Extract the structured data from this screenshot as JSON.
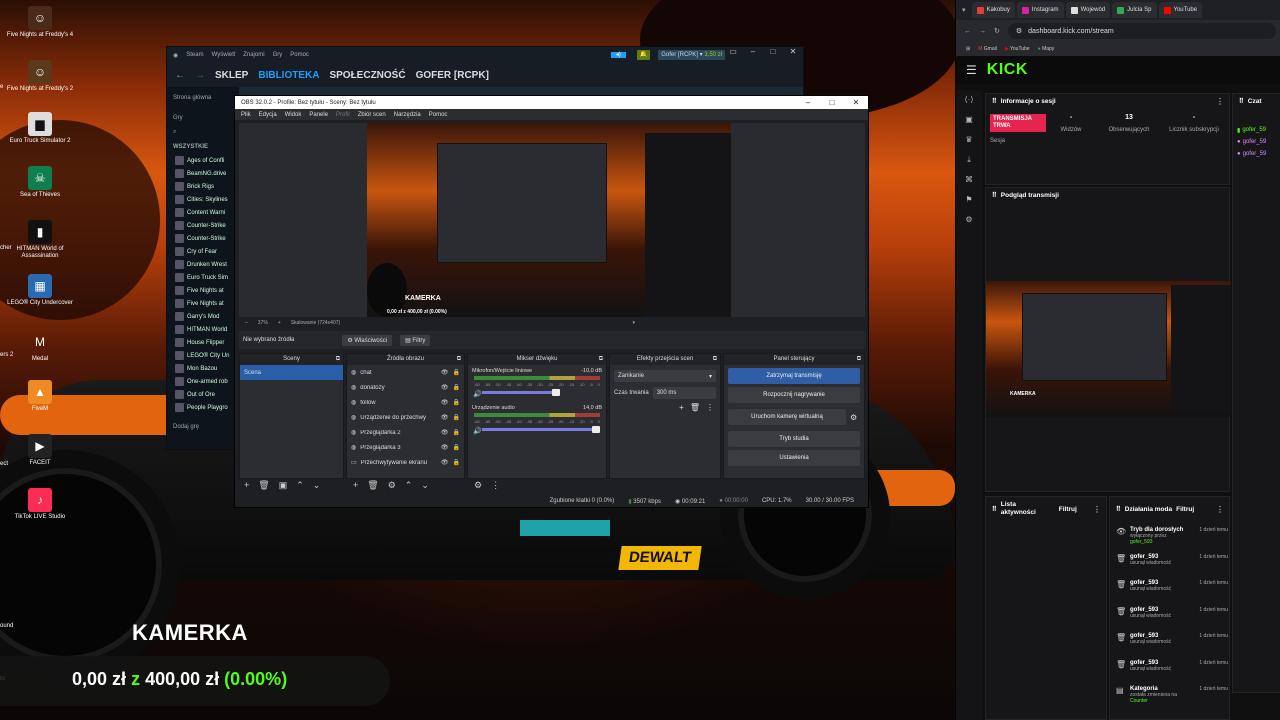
{
  "desktop": {
    "icons": [
      {
        "label": "Five Nights at Freddy's 4"
      },
      {
        "label": "Five Nights at Freddy's 2"
      },
      {
        "label": "Euro Truck Simulator 2"
      },
      {
        "label": "Sea of Thieves"
      },
      {
        "label": "HITMAN World of Assassination"
      },
      {
        "label": "LEGO® City Undercover"
      },
      {
        "label": "Medal"
      },
      {
        "label": "FiveM"
      },
      {
        "label": "FACEIT"
      },
      {
        "label": "TikTok LIVE Studio"
      }
    ],
    "edge_labels": [
      "e",
      "cher",
      "ers 2",
      "ect",
      "ound",
      "lic"
    ],
    "overlay": {
      "title": "KAMERKA",
      "current": "0,00 zł",
      "sep": "z",
      "target": "400,00 zł",
      "percent": "(0.00%)"
    },
    "car_sponsor": "DEWALT"
  },
  "steam": {
    "menu": [
      "Steam",
      "Wyświetl",
      "Znajomi",
      "Gry",
      "Pomoc"
    ],
    "nav": [
      "SKLEP",
      "BIBLIOTEKA",
      "SPOŁECZNOŚĆ",
      "GOFER [RCPK]"
    ],
    "user_badge": "Gofer [RCPK]",
    "balance": "3,50 zł",
    "home": "Strona główna",
    "games_label": "Gry",
    "all_label": "WSZYSTKIE",
    "games": [
      "Ages of Confli",
      "BeamNG.drive",
      "Brick Rigs",
      "Cities: Skylines",
      "Content Warni",
      "Counter-Strike",
      "Counter-Strike",
      "Cry of Fear",
      "Drunken Wrest",
      "Euro Truck Sim",
      "Five Nights at",
      "Five Nights at",
      "Garry's Mod",
      "HITMAN World",
      "House Flipper",
      "LEGO® City Un",
      "Mon Bazou",
      "One-armed rob",
      "Out of Ore",
      "People Playgro"
    ],
    "add_game": "Dodaj grę"
  },
  "obs": {
    "title": "OBS 32.0.2 - Profile: Bez tytułu - Sceny: Bez tytułu",
    "menu": [
      "Plik",
      "Edycja",
      "Widok",
      "Panele",
      "Profil",
      "Zbiór scen",
      "Narzędzia",
      "Pomoc"
    ],
    "zoom": "37%",
    "scaling": "Skalowanie (724x407)",
    "no_source": "Nie wybrano źródła",
    "properties": "Właściwości",
    "filters": "Filtry",
    "docks": {
      "scenes": "Sceny",
      "sources": "Źródła obrazu",
      "mixer": "Mikser dźwięku",
      "transitions": "Efekty przejścia scen",
      "controls": "Panel sterujący"
    },
    "scene_items": [
      "Scena"
    ],
    "sources": [
      "chat",
      "donatozy",
      "follow",
      "Urządzenie do przechwy",
      "Przeglądarka 2",
      "Przeglądarka 3",
      "Przechwytywanie ekranu"
    ],
    "mixer": [
      {
        "name": "Mikrofon/Wejście liniowe",
        "db": "-10,0 dB"
      },
      {
        "name": "Urządzenie audio",
        "db": "14,0 dB"
      }
    ],
    "mixer_scale": [
      "-60",
      "-55",
      "-50",
      "-45",
      "-40",
      "-35",
      "-30",
      "-25",
      "-20",
      "-15",
      "-10",
      "-5",
      "0"
    ],
    "transition": "Zanikanie",
    "duration_label": "Czas trwania",
    "duration": "300 ms",
    "controls": [
      "Zatrzymaj transmisję",
      "Rozpocznij nagrywanie",
      "Uruchom kamerę wirtualną",
      "Tryb studia",
      "Ustawienia"
    ],
    "preview": {
      "kamerka": "KAMERKA",
      "goal": "0,00 zł z 400,00 zł (0.00%)"
    },
    "status": {
      "dropped": "Zgubione klatki 0 (0.0%)",
      "bitrate": "3507 kbps",
      "live_time": "00:09:21",
      "rec_time": "00:00:00",
      "cpu": "CPU: 1.7%",
      "fps": "30.00 / 30.00 FPS"
    }
  },
  "browser": {
    "tabs": [
      {
        "label": "Kakobuy",
        "color": "#e23d3d"
      },
      {
        "label": "Instagram",
        "color": "#d6249f"
      },
      {
        "label": "Wojewód",
        "color": "#dddddd"
      },
      {
        "label": "Julcia Sp",
        "color": "#34a853"
      },
      {
        "label": "YouTube",
        "color": "#ff0000"
      }
    ],
    "url": "dashboard.kick.com/stream",
    "bookmarks": [
      "Gmail",
      "YouTube",
      "Mapy"
    ],
    "kick": {
      "logo": "KICK",
      "session_title": "Informacje o sesji",
      "live_badge": "TRANSMISJA TRWA",
      "session_label": "Sesja",
      "stats": [
        {
          "value": "-",
          "label": "Widzów"
        },
        {
          "value": "13",
          "label": "Obserwujących"
        },
        {
          "value": "-",
          "label": "Licznik subskrypcji"
        }
      ],
      "chat_title": "Czat",
      "chat_users": [
        "gofer_59",
        "gofer_59",
        "gofer_59"
      ],
      "preview_title": "Podgląd transmisji",
      "preview_kamerka": "KAMERKA",
      "activity_title": "Lista aktywności",
      "activity_filter": "Filtruj",
      "modactions_title": "Działania moda",
      "modactions_filter": "Filtruj",
      "mod_actions": [
        {
          "title": "Tryb dla dorosłych",
          "sub": "wyłączony przez",
          "user": "gofer_593",
          "time": "1 dzień temu",
          "icon": "eye-icon"
        },
        {
          "title": "gofer_593",
          "sub": "usunął wiadomość",
          "user": "",
          "time": "1 dzień temu",
          "icon": "trash-icon"
        },
        {
          "title": "gofer_593",
          "sub": "usunął wiadomość",
          "user": "",
          "time": "1 dzień temu",
          "icon": "trash-icon"
        },
        {
          "title": "gofer_593",
          "sub": "usunął wiadomość",
          "user": "",
          "time": "1 dzień temu",
          "icon": "trash-icon"
        },
        {
          "title": "gofer_593",
          "sub": "usunął wiadomość",
          "user": "",
          "time": "1 dzień temu",
          "icon": "trash-icon"
        },
        {
          "title": "gofer_593",
          "sub": "usunął wiadomość",
          "user": "",
          "time": "1 dzień temu",
          "icon": "trash-icon"
        },
        {
          "title": "Kategoria",
          "sub": "została zmieniona na",
          "user": "Counter",
          "time": "1 dzień temu",
          "icon": "category-icon"
        }
      ]
    }
  },
  "colors": {
    "kick_green": "#53fc18",
    "obs_blue": "#2b5ea8",
    "live_red": "#e6244f"
  }
}
